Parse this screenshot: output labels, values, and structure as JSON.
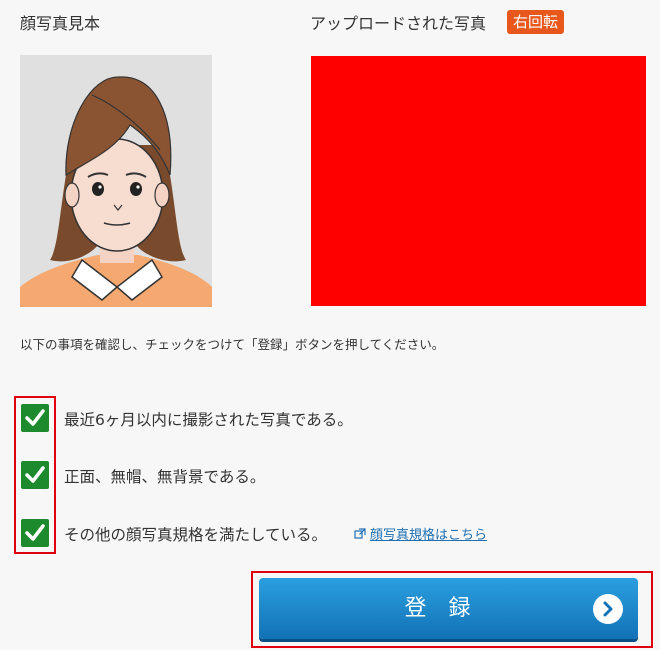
{
  "sample_title": "顔写真見本",
  "upload_title": "アップロードされた写真",
  "rotate_button": "右回転",
  "uploaded_photo_color": "#ff0000",
  "instruction": "以下の事項を確認し、チェックをつけて「登録」ボタンを押してください。",
  "checklist": [
    {
      "label": "最近6ヶ月以内に撮影された写真である。",
      "checked": true
    },
    {
      "label": "正面、無帽、無背景である。",
      "checked": true
    },
    {
      "label": "その他の顔写真規格を満たしている。",
      "checked": true
    }
  ],
  "spec_link": "顔写真規格はこちら",
  "register_button": "登録",
  "colors": {
    "accent_orange": "#e8581c",
    "check_green": "#1e8a2e",
    "button_blue": "#1a87cc",
    "highlight_red": "#e00010",
    "link_blue": "#1f6fb2"
  },
  "icons": {
    "checkbox": "checkmark-icon",
    "external": "external-link-icon",
    "arrow": "chevron-right-circle-icon"
  }
}
